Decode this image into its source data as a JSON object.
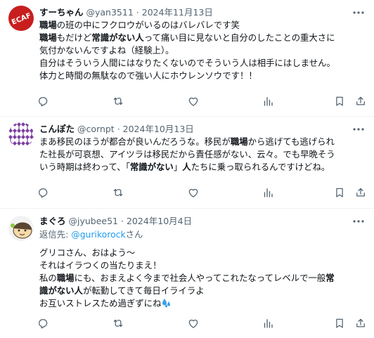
{
  "posts": [
    {
      "name": "すーちゃん",
      "handle": "@yan3511",
      "sep": "·",
      "date": "2024年11月13日",
      "avatar_text": "ECAF",
      "lines": [
        [
          {
            "t": "職場",
            "b": true
          },
          {
            "t": "の班の中にフクロウがいるのはバレバレです笑"
          }
        ],
        [
          {
            "t": "職場",
            "b": true
          },
          {
            "t": "もだけど"
          },
          {
            "t": "常識がない人",
            "b": true
          },
          {
            "t": "って痛い目に見ないと自分のしたことの重大さに"
          }
        ],
        [
          {
            "t": "気付かないんですよね（経験上）。"
          }
        ],
        [
          {
            "t": "自分はそういう人間にはなりたくないのでそういう人は相手にはしません。"
          }
        ],
        [
          {
            "t": "体力と時間の無駄なので強い人にホウレンソウです！！"
          }
        ]
      ]
    },
    {
      "name": "こんぽた",
      "handle": "@cornpt",
      "sep": "·",
      "date": "2024年10月13日",
      "lines": [
        [
          {
            "t": "まあ移民のほうが都合が良いんだろうな。移民が"
          },
          {
            "t": "職場",
            "b": true
          },
          {
            "t": "から逃げても逃げられ"
          }
        ],
        [
          {
            "t": "た社長が可哀想、アイツラは移民だから責任感がない、云々。でも早晩そう"
          }
        ],
        [
          {
            "t": "いう時期は終わって、「"
          },
          {
            "t": "常識がない",
            "b": true
          },
          {
            "t": "」"
          },
          {
            "t": "人",
            "b": true
          },
          {
            "t": "たちに乗っ取られるんですけどね。"
          }
        ]
      ]
    },
    {
      "name": "まぐろ",
      "handle": "@jyubee51",
      "sep": "·",
      "date": "2024年10月4日",
      "reply_prefix": "返信先: ",
      "reply_user": "@gurikorock",
      "reply_suffix": "さん",
      "lines": [
        [
          {
            "t": "グリコさん、おはよう～"
          }
        ],
        [
          {
            "t": "それはイラつくの当たりまえ！"
          }
        ],
        [
          {
            "t": "私の"
          },
          {
            "t": "職場",
            "b": true
          },
          {
            "t": "にも、おまえよく今まで社会人やってこれたなってレベルで一般"
          },
          {
            "t": "常",
            "b": true
          }
        ],
        [
          {
            "t": "識がない人",
            "b": true
          },
          {
            "t": "が転勤してきて毎日イライラよ"
          }
        ],
        [
          {
            "t": "お互いストレスため過ぎずにね"
          }
        ]
      ]
    }
  ],
  "icons": [
    "more-icon",
    "reply-icon",
    "retweet-icon",
    "like-icon",
    "views-icon",
    "bookmark-icon",
    "share-icon",
    "water-drops-emoji"
  ],
  "colors": {
    "text": "#0f1419",
    "secondary": "#536471",
    "link": "#1d9bf0",
    "border": "#eff3f4",
    "avatar1_bg": "#c81e1e"
  }
}
